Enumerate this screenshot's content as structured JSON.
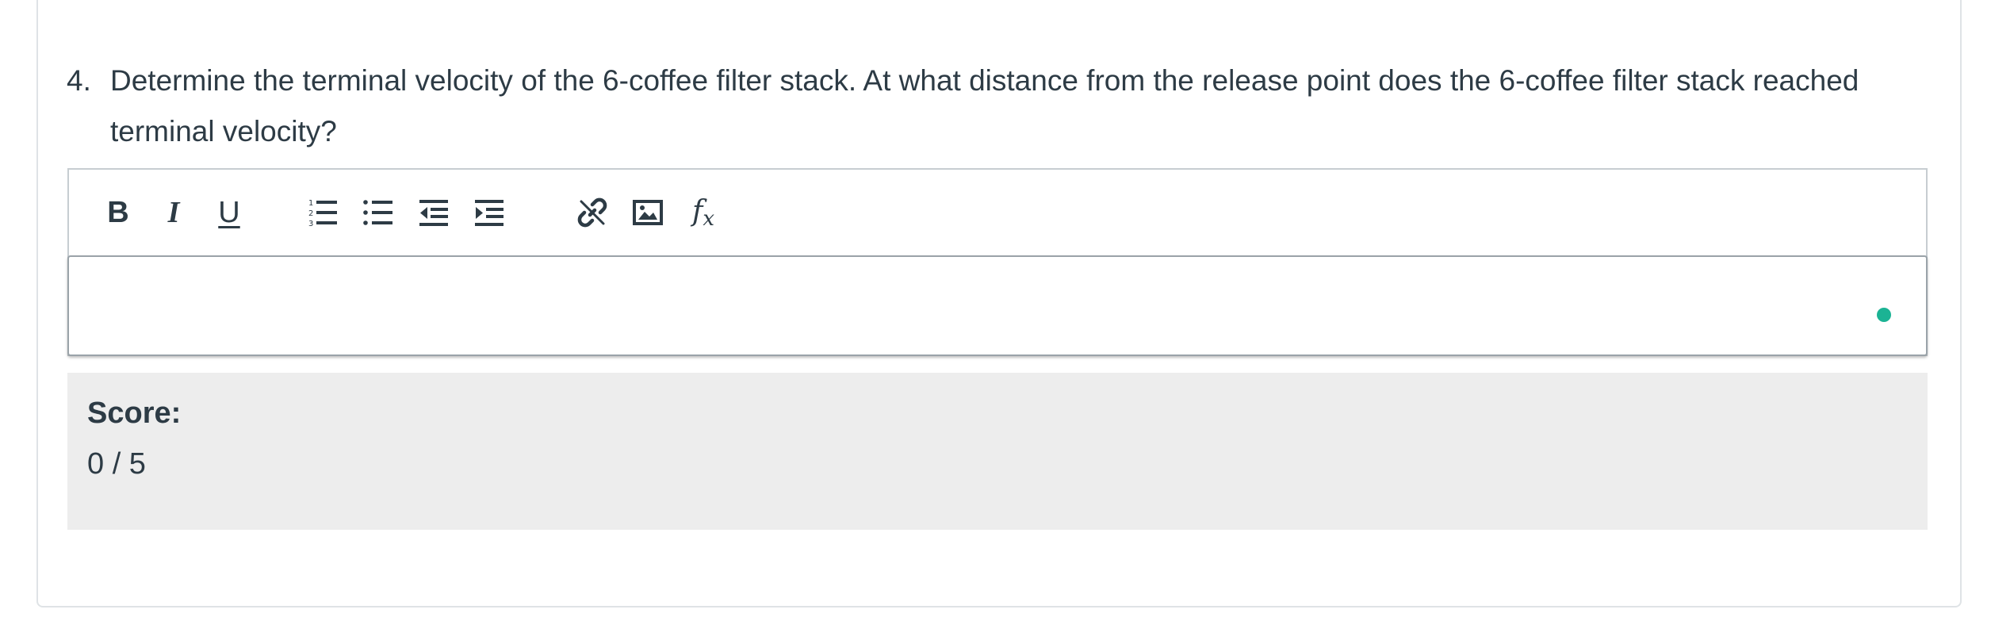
{
  "question": {
    "number": "4.",
    "text": "Determine the terminal velocity of the 6-coffee filter stack. At what distance from the release point does the 6-coffee filter stack reached terminal velocity?"
  },
  "toolbar": {
    "buttons": [
      {
        "name": "bold",
        "label": "B",
        "icon": "bold-icon"
      },
      {
        "name": "italic",
        "label": "I",
        "icon": "italic-icon"
      },
      {
        "name": "underline",
        "label": "U",
        "icon": "underline-icon"
      },
      {
        "name": "ordered-list",
        "icon": "ordered-list-icon"
      },
      {
        "name": "unordered-list",
        "icon": "unordered-list-icon"
      },
      {
        "name": "outdent",
        "icon": "outdent-icon"
      },
      {
        "name": "indent",
        "icon": "indent-icon"
      },
      {
        "name": "link",
        "icon": "link-icon"
      },
      {
        "name": "image",
        "icon": "image-icon"
      },
      {
        "name": "equation",
        "label_main": "f",
        "label_sub": "x",
        "icon": "equation-icon"
      }
    ]
  },
  "editor": {
    "value": "",
    "status_color": "#1bb394"
  },
  "score": {
    "label": "Score:",
    "value": "0 / 5"
  }
}
